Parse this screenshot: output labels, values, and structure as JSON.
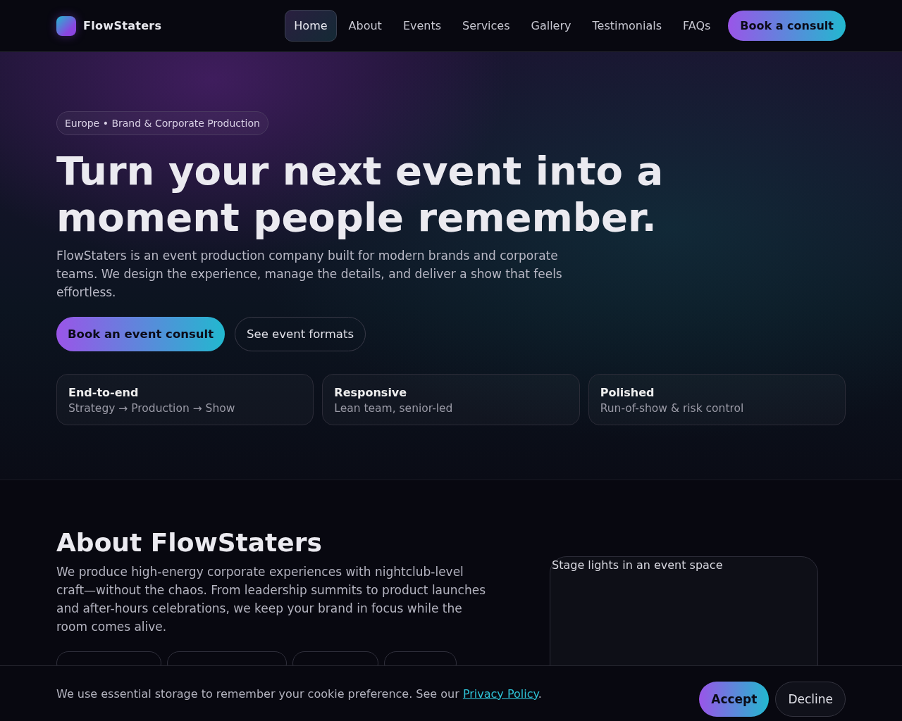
{
  "header": {
    "brand": "FlowStaters",
    "nav": [
      {
        "label": "Home",
        "selected": true
      },
      {
        "label": "About",
        "selected": false
      },
      {
        "label": "Events",
        "selected": false
      },
      {
        "label": "Services",
        "selected": false
      },
      {
        "label": "Gallery",
        "selected": false
      },
      {
        "label": "Testimonials",
        "selected": false
      },
      {
        "label": "FAQs",
        "selected": false
      }
    ],
    "cta": "Book a consult"
  },
  "hero": {
    "badge": "Europe • Brand & Corporate Production",
    "title": "Turn your next event into a moment people remember.",
    "text": "FlowStaters is an event production company built for modern brands and corporate teams. We design the experience, manage the details, and deliver a show that feels effortless.",
    "buttons": [
      {
        "label": "Book an event consult",
        "kind": "primary"
      },
      {
        "label": "See event formats",
        "kind": "secondary"
      }
    ],
    "features": [
      {
        "title": "End-to-end",
        "text": "Strategy → Production → Show"
      },
      {
        "title": "Responsive",
        "text": "Lean team, senior-led"
      },
      {
        "title": "Polished",
        "text": "Run-of-show & risk control"
      }
    ]
  },
  "about": {
    "title": "About FlowStaters",
    "text": "We produce high-energy corporate experiences with nightclub-level craft—without the chaos. From leadership summits to product launches and after-hours celebrations, we keep your brand in focus while the room comes alive.",
    "image_alt": "Stage lights in an event space"
  },
  "cookie_banner": {
    "text": "We use essential storage to remember your cookie preference. See our ",
    "link": "Privacy Policy",
    "after": ".",
    "buttons": [
      {
        "label": "Accept",
        "kind": "primary"
      },
      {
        "label": "Decline",
        "kind": "secondary"
      }
    ]
  }
}
